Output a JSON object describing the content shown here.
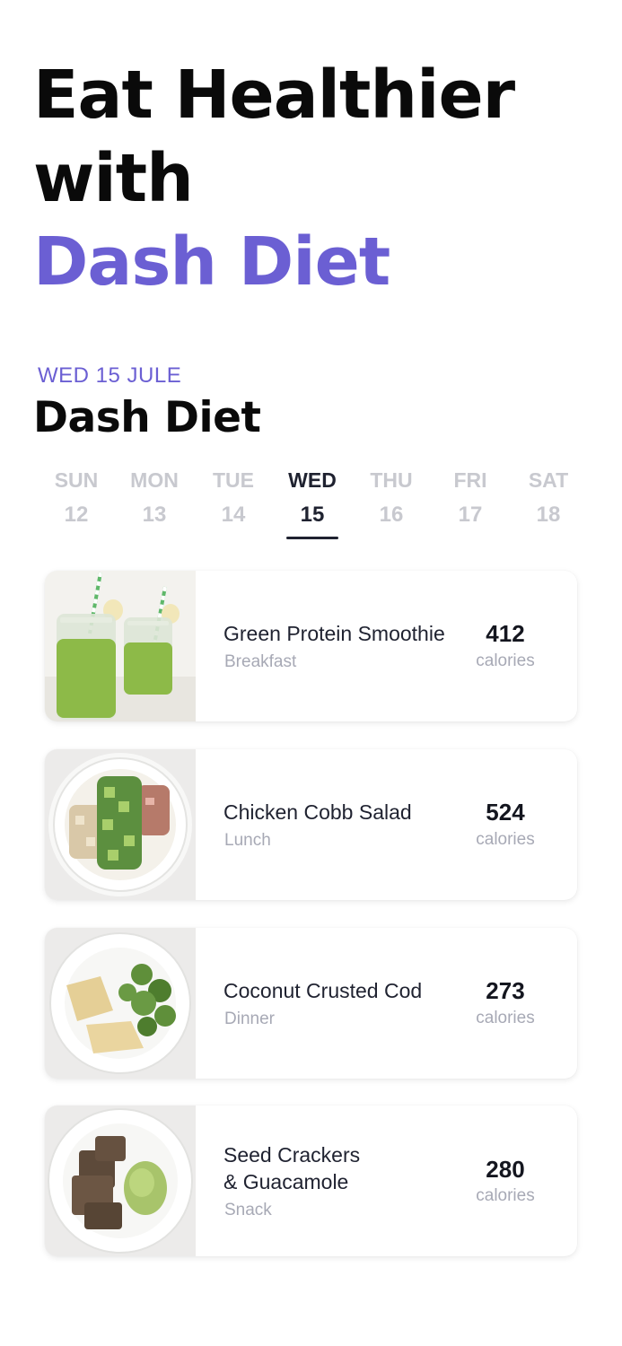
{
  "hero": {
    "line1": "Eat Healthier",
    "line2": "with",
    "line3": "Dash Diet"
  },
  "schedule": {
    "date_label": "WED 15 JULE",
    "title": "Dash Diet",
    "days": [
      {
        "name": "SUN",
        "num": "12"
      },
      {
        "name": "MON",
        "num": "13"
      },
      {
        "name": "TUE",
        "num": "14"
      },
      {
        "name": "WED",
        "num": "15"
      },
      {
        "name": "THU",
        "num": "16"
      },
      {
        "name": "FRI",
        "num": "17"
      },
      {
        "name": "SAT",
        "num": "18"
      }
    ],
    "selected_day": "WED"
  },
  "meals": [
    {
      "name": "Green Protein Smoothie",
      "type": "Breakfast",
      "calories": "412",
      "unit": "calories"
    },
    {
      "name": "Chicken Cobb Salad",
      "type": "Lunch",
      "calories": "524",
      "unit": "calories"
    },
    {
      "name": "Coconut Crusted Cod",
      "type": "Dinner",
      "calories": "273",
      "unit": "calories"
    },
    {
      "name_line1": "Seed Crackers",
      "name_line2": "& Guacamole",
      "type": "Snack",
      "calories": "280",
      "unit": "calories"
    }
  ],
  "colors": {
    "accent": "#6b5fd3",
    "text_dark": "#1f2230",
    "muted": "#a7a9b5",
    "inactive_day": "#c8c9cf"
  }
}
